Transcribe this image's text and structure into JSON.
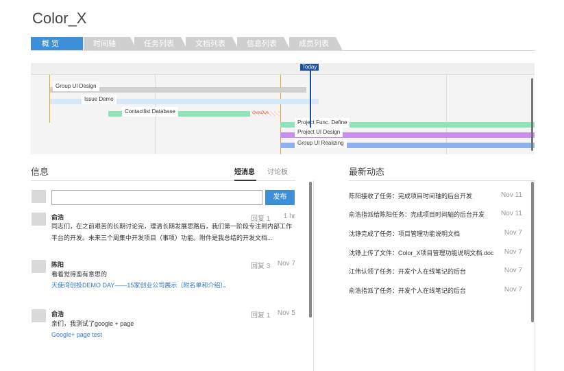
{
  "app": {
    "title": "Color_X"
  },
  "tabs": [
    {
      "label": "概 览",
      "active": true
    },
    {
      "label": "时间轴",
      "active": false
    },
    {
      "label": "任务列表",
      "active": false
    },
    {
      "label": "文档列表",
      "active": false
    },
    {
      "label": "信息列表",
      "active": false
    },
    {
      "label": "成员列表",
      "active": false
    }
  ],
  "gantt": {
    "today_label": "Today",
    "tasks": [
      {
        "label": "Group UI Design",
        "color": "#d0d0d0"
      },
      {
        "label": "Issue Demo",
        "color": "#d7e8f6"
      },
      {
        "label": "Contactlist Database",
        "color": "#8fe3b8"
      },
      {
        "label": "Project Func. Define",
        "color": "#8fe3b8"
      },
      {
        "label": "Project UI Design",
        "color": "#c98ff0"
      },
      {
        "label": "Group UI Realizing",
        "color": "#8fb2ee"
      }
    ],
    "overdue_label": "OverDue"
  },
  "messages_panel": {
    "title": "信息",
    "subtabs": [
      {
        "label": "短消息",
        "active": true
      },
      {
        "label": "讨论板",
        "active": false
      }
    ],
    "input_value": "",
    "publish_label": "发布",
    "messages": [
      {
        "author": "俞浩",
        "reply": "回复 1",
        "time": "1 hr",
        "lines": [
          {
            "text": "同志们，在之前艰苦的长期讨论完，理清长期发展思路后，我们第一阶段专注到内部工作",
            "link": false
          },
          {
            "text": "平台的开发。未来三个周集中开发项目（事项）功能。附件是我总结的开发文档...",
            "link": false
          }
        ]
      },
      {
        "author": "陈阳",
        "reply": "回复 3",
        "time": "Nov 7",
        "lines": [
          {
            "text": "看着觉得蛮有意思的",
            "link": false
          },
          {
            "text": "天使湾创投DEMO DAY——15家创业公司展示（附名单和介绍）。",
            "link": true
          }
        ]
      },
      {
        "author": "俞浩",
        "reply": "回复 1",
        "time": "Nov 5",
        "lines": [
          {
            "text": "亲们，我测试了google + page",
            "link": false
          },
          {
            "text": "Google+ page test",
            "link": true
          }
        ]
      }
    ]
  },
  "activity_panel": {
    "title": "最新动态",
    "items": [
      {
        "text": "陈阳接收了任务：完成项目时间轴的后台开发",
        "date": "Nov 11"
      },
      {
        "text": "俞浩指派给陈阳任务：完成项目时间轴的后台开发",
        "date": "Nov 11"
      },
      {
        "text": "沈铮完成了任务：项目管理功能说明文档",
        "date": "Nov 7"
      },
      {
        "text": "沈铮上传了文件：Color_X项目管理功能说明文档.doc",
        "date": "Nov 7"
      },
      {
        "text": "江伟认领了任务：开发个人在线笔记的后台",
        "date": "Nov 7"
      },
      {
        "text": "俞浩指派了任务：开发个人在线笔记的后台",
        "date": "Nov 7"
      }
    ]
  }
}
